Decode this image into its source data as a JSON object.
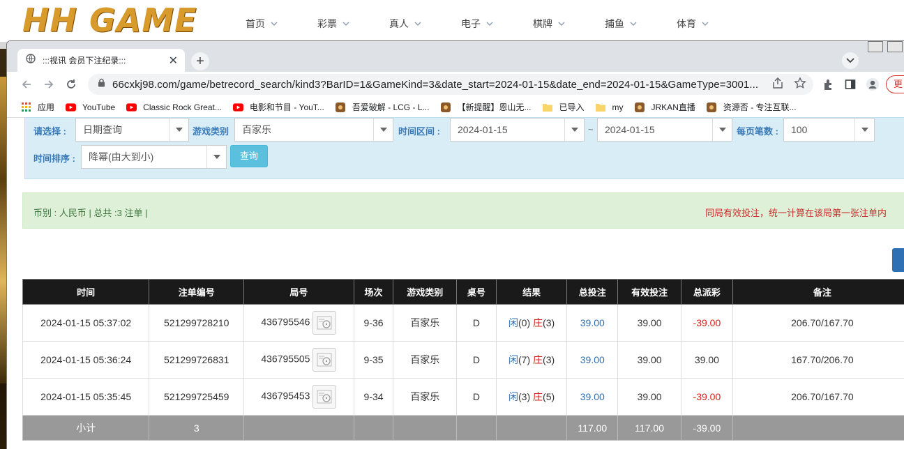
{
  "site": {
    "logo": "HH GAME",
    "nav": [
      "首页",
      "彩票",
      "真人",
      "电子",
      "棋牌",
      "捕鱼",
      "体育"
    ]
  },
  "browser": {
    "tab_title": ":::视讯 会员下注纪录:::",
    "url": "66cxkj98.com/game/betrecord_search/kind3?BarID=1&GameKind=3&date_start=2024-01-15&date_end=2024-01-15&GameType=3001...",
    "update_label": "更",
    "bookmarks": [
      {
        "label": "应用",
        "icon": "apps-grid-icon"
      },
      {
        "label": "YouTube",
        "icon": "youtube-icon"
      },
      {
        "label": "Classic Rock Great...",
        "icon": "youtube-icon"
      },
      {
        "label": "电影和节目 - YouT...",
        "icon": "youtube-icon"
      },
      {
        "label": "吾爱破解 - LCG - L...",
        "icon": "site-icon"
      },
      {
        "label": "【新提醒】恩山无...",
        "icon": "site-icon"
      },
      {
        "label": "已导入",
        "icon": "folder-icon"
      },
      {
        "label": "my",
        "icon": "folder-icon"
      },
      {
        "label": "JRKAN直播",
        "icon": "site-icon"
      },
      {
        "label": "资源否 - 专注互联...",
        "icon": "site-icon"
      }
    ]
  },
  "filters": {
    "select_label": "请选择 :",
    "select_value": "日期查询",
    "game_label": "游戏类别",
    "game_value": "百家乐",
    "range_label": "时间区间 :",
    "date_start": "2024-01-15",
    "tilde": "~",
    "date_end": "2024-01-15",
    "per_page_label": "每页笔数 :",
    "per_page_value": "100",
    "sort_label": "时间排序 :",
    "sort_value": "降幂(由大到小)",
    "query_button": "查询"
  },
  "summary": {
    "left": "币别 : 人民币 | 总共 :3 注单 |",
    "right": "同局有效投注，统一计算在该局第一张注单内"
  },
  "table": {
    "headers": [
      "时间",
      "注单编号",
      "局号",
      "场次",
      "游戏类别",
      "桌号",
      "结果",
      "总投注",
      "有效投注",
      "总派彩",
      "备注"
    ],
    "rows": [
      {
        "time": "2024-01-15 05:37:02",
        "order": "521299728210",
        "round": "436795546",
        "session": "9-36",
        "game": "百家乐",
        "table": "D",
        "player_label": "闲",
        "player_val": "(0)",
        "banker_label": "庄",
        "banker_val": "(3)",
        "total_bet": "39.00",
        "valid_bet": "39.00",
        "payout": "-39.00",
        "payout_neg": true,
        "note": "206.70/167.70"
      },
      {
        "time": "2024-01-15 05:36:24",
        "order": "521299726831",
        "round": "436795505",
        "session": "9-35",
        "game": "百家乐",
        "table": "D",
        "player_label": "闲",
        "player_val": "(7)",
        "banker_label": "庄",
        "banker_val": "(3)",
        "total_bet": "39.00",
        "valid_bet": "39.00",
        "payout": "39.00",
        "payout_neg": false,
        "note": "167.70/206.70"
      },
      {
        "time": "2024-01-15 05:35:45",
        "order": "521299725459",
        "round": "436795453",
        "session": "9-34",
        "game": "百家乐",
        "table": "D",
        "player_label": "闲",
        "player_val": "(3)",
        "banker_label": "庄",
        "banker_val": "(5)",
        "total_bet": "39.00",
        "valid_bet": "39.00",
        "payout": "-39.00",
        "payout_neg": true,
        "note": "206.70/167.70"
      }
    ],
    "subtotal": {
      "label": "小计",
      "count": "3",
      "total_bet": "117.00",
      "valid_bet": "117.00",
      "payout": "-39.00"
    }
  },
  "colors": {
    "accent_blue": "#2f6fb3",
    "negative_red": "#d9201a",
    "header_black": "#1a1a1a",
    "filter_bg": "#d9edf7",
    "summary_bg": "#dff0d8"
  }
}
